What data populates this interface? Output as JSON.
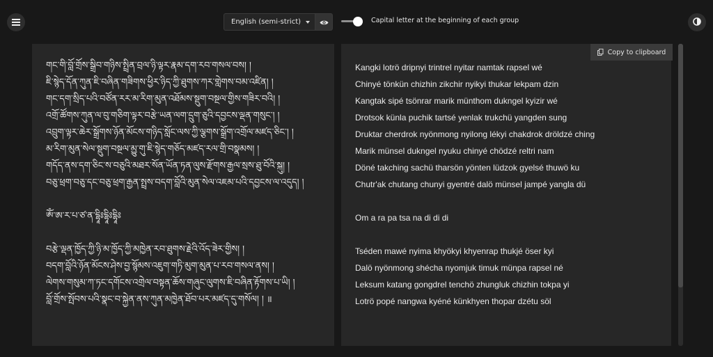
{
  "toolbar": {
    "menu_icon": "hamburger-icon",
    "mode_select": {
      "selected": "English (semi-strict)"
    },
    "eye_icon": "eye-icon",
    "capital_toggle": {
      "label": "Capital letter at the beginning of each group",
      "on": true
    },
    "theme_icon": "contrast-icon"
  },
  "input": {
    "tibetan_lines": [
      "གང་གི་བློ་གྲོས་སྒྲིབ་གཉིས་སྤྲིན་བྲལ་ཉི་ལྟར་རྣམ་དག་རབ་གསལ་བས། །",
      "ཇི་སྙེད་དོན་ཀུན་ཇི་བཞིན་གཟིགས་ཕྱིར་ཉིད་ཀྱི་ཐུགས་ཀར་གླེགས་བམ་འཛིན། །",
      "གང་དག་སྲིད་པའི་བཙོན་རར་མ་རིག་མུན་འཐོམས་སྡུག་བསྔལ་གྱིས་གཟིར་བའི། །",
      "འགྲོ་ཚོགས་ཀུན་ལ་བུ་གཅིག་ལྟར་བརྩེ་ཡན་ལག་དྲུག་ཅུའི་དབྱངས་ལྡན་གསུང་། །",
      "འབྲུག་ལྟར་ཆེར་སྒྲོགས་ཉོན་མོངས་གཉིད་སློང་ལས་ཀྱི་ལྕགས་སྒྲོག་འགྲོལ་མཛད་ཅིང་། །",
      "མ་རིག་མུན་སེལ་སྡུག་བསྔལ་མྱུ་གུ་ཇི་སྙེད་གཅོད་མཛད་རལ་གྲི་བསྣམས། །",
      "གདོད་ནས་དག་ཅིང་ས་བཅུའི་མཐར་སོན་ཡོན་ཏན་ལུས་རྫོགས་རྒྱལ་སྲས་ཐུ་བོའི་སྐུ། །",
      "བཅུ་ཕྲག་བཅུ་དང་བཅུ་ཕྲག་རྒྱན་སྤྲས་བདག་བློའི་མུན་སེལ་འཇམ་པའི་དབྱངས་ལ་འདུད། །",
      "",
      "ཨོཾ་ཨ་ར་པ་ཙ་ན་དྷཱིཿདྷཱིཿདྷཱིཿ",
      "",
      "བརྩེ་ལྡན་ཁྱོད་ཀྱི་ཉི་མ་ཁྱོད་ཀྱི་མཁྱེན་རབ་ཐུགས་རྗེའི་འོད་ཟེར་གྱིས། །",
      "བདག་བློའི་ཉོན་མོངས་ཤེས་བྱ་སྙོམས་འཇུག་གཏི་མུག་མུན་པ་རབ་གསལ་ནས། །",
      "ལེགས་གསུམ་ཀ་ཏང་དགོངས་འགྲེལ་བསྟན་ཆོས་གཞུང་ལུགས་ཇི་བཞིན་རྟོགས་པ་ཡི། །",
      "བློ་གྲོས་སྤོབས་པའི་སྣང་བ་སྐྱེན་ནས་ཀུན་མཁྱེན་ཐོབ་པར་མཛད་དུ་གསོལ། ། ॥"
    ]
  },
  "output": {
    "copy_button": {
      "label": "Copy to clipboard",
      "icon": "clipboard-icon"
    },
    "lines": [
      "Kangki lotrö dripnyi trintrel nyitar namtak rapsel wé",
      "Chinyé tönkün chizhin zikchir nyikyi thukar lekpam dzin",
      "Kangtak sipé tsönrar marik münthom dukngel kyizir wé",
      "Drotsok künla puchik tartsé yenlak trukchü yangden sung",
      "Druktar cherdrok nyönmong nyilong lékyi chakdrok dröldzé ching",
      "Marik münsel dukngel nyuku chinyé chödzé reltri nam",
      "Döné takching sachü tharsön yönten lüdzok gyelsé thuwö ku",
      "Chutr'ak chutang chunyi gyentré dalö münsel jampé yangla dü",
      "",
      "Om a ra pa tsa na di di di",
      "",
      "Tséden mawé nyima khyökyi khyenrap thukjé öser kyi",
      "Dalö nyönmong shécha nyomjuk timuk münpa rapsel né",
      "Leksum katang gongdrel tenchö zhungluk chizhin tokpa yi",
      "Lotrö popé nangwa kyéné künkhyen thopar dzétu söl"
    ]
  }
}
